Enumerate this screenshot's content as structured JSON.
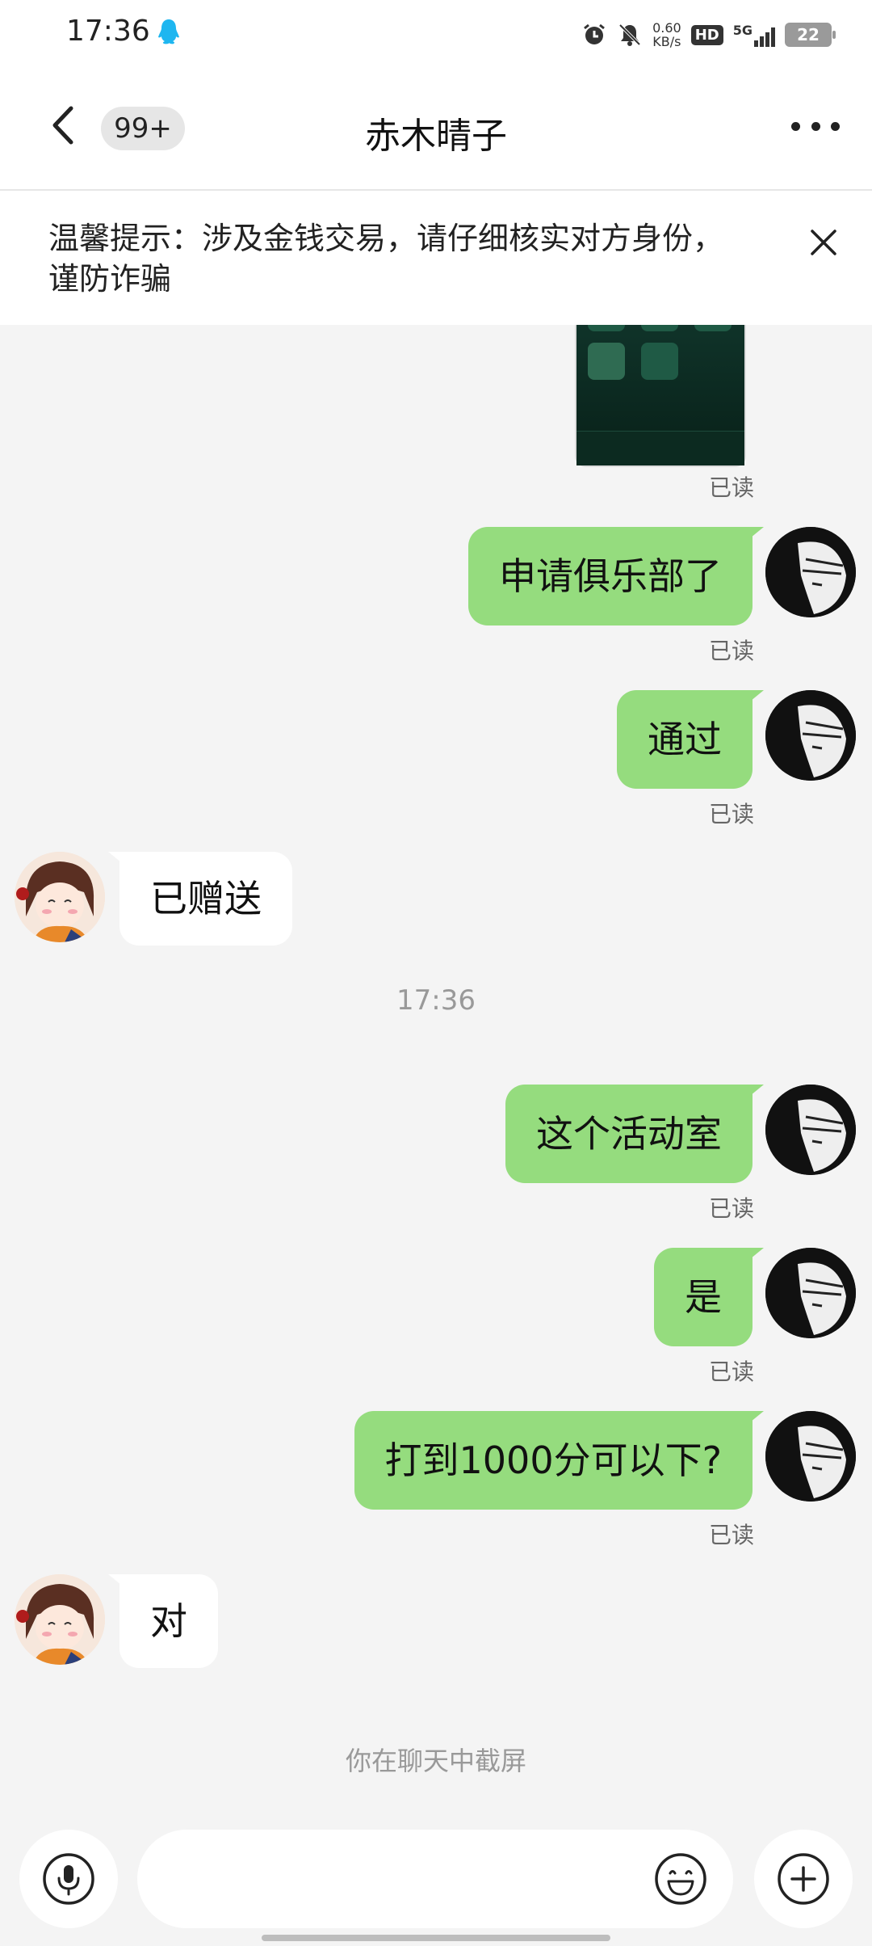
{
  "status_bar": {
    "time": "17:36",
    "net_speed_value": "0.60",
    "net_speed_unit": "KB/s",
    "hd": "HD",
    "signal": "5G",
    "battery": "22",
    "icons": [
      "qq-notification-icon",
      "alarm-icon",
      "mute-icon",
      "signal-icon",
      "battery-icon"
    ]
  },
  "header": {
    "back_icon": "chevron-left-icon",
    "unread_count": "99+",
    "title": "赤木晴子",
    "more_icon": "more-dots-icon"
  },
  "notice": {
    "text": "温馨提示：涉及金钱交易，请仔细核实对方身份，谨防诈骗",
    "close_icon": "close-icon"
  },
  "messages": {
    "read_label": "已读",
    "m1": "申请俱乐部了",
    "m2": "通过",
    "m3": "已赠送",
    "time_divider": "17:36",
    "m4": "这个活动室",
    "m5": "是",
    "m6": "打到1000分可以下?",
    "m7": "对",
    "screenshot_note": "你在聊天中截屏"
  },
  "input_bar": {
    "voice_icon": "microphone-icon",
    "emoji_icon": "emoji-icon",
    "plus_icon": "plus-icon",
    "placeholder": ""
  },
  "colors": {
    "outgoing_bubble": "#95dc7e",
    "incoming_bubble": "#ffffff",
    "background": "#f4f4f4"
  }
}
